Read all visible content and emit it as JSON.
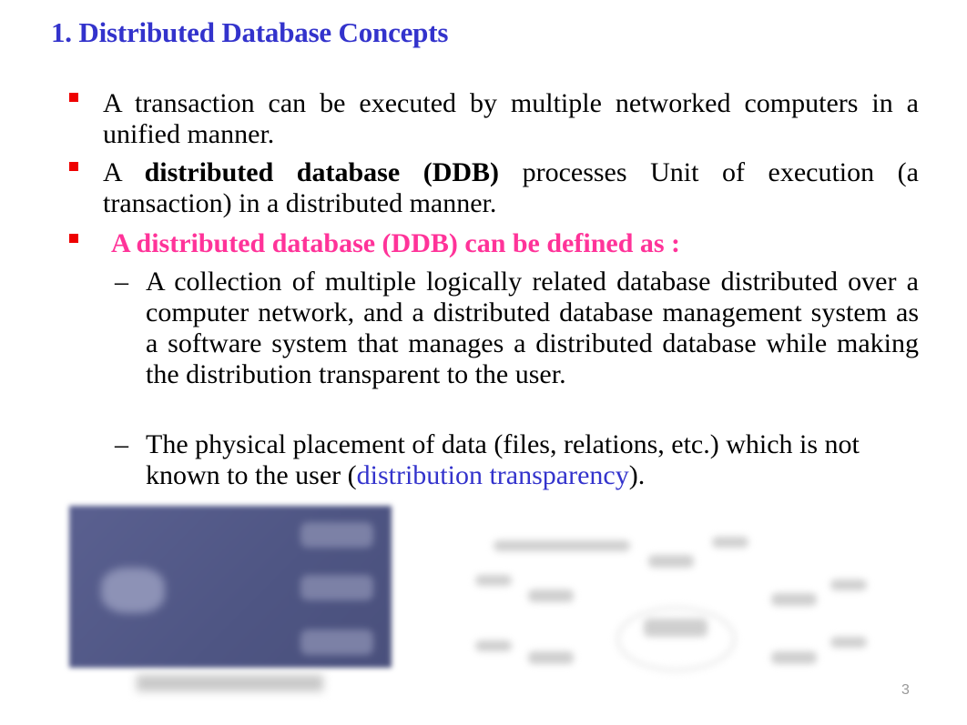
{
  "slide": {
    "title": "1. Distributed Database Concepts",
    "bullets": [
      {
        "text": "A transaction can be executed by multiple networked computers in a unified manner."
      },
      {
        "pre": "A ",
        "bold": "distributed database (DDB)",
        "post": " processes Unit of execution (a transaction) in a distributed manner."
      },
      {
        "text": "A distributed database (DDB) can be defined as :"
      }
    ],
    "subbullets": [
      {
        "text": "A collection of multiple logically related database distributed over a computer network, and a distributed database management system as a software system that manages a distributed database while making the distribution transparent to the user."
      },
      {
        "pre": "The physical placement of data (files, relations, etc.) which is not known to the user (",
        "link": "distribution transparency",
        "post": ")."
      }
    ],
    "dash": "–",
    "images": [
      {
        "name": "distributed-database-illustration",
        "caption_visible": false
      },
      {
        "name": "network-diagram",
        "caption_visible": false
      }
    ],
    "page_number": "3",
    "colors": {
      "title": "#3333cc",
      "bullet": "#ee0000",
      "highlight": "#ff3399",
      "link": "#3333cc"
    }
  }
}
